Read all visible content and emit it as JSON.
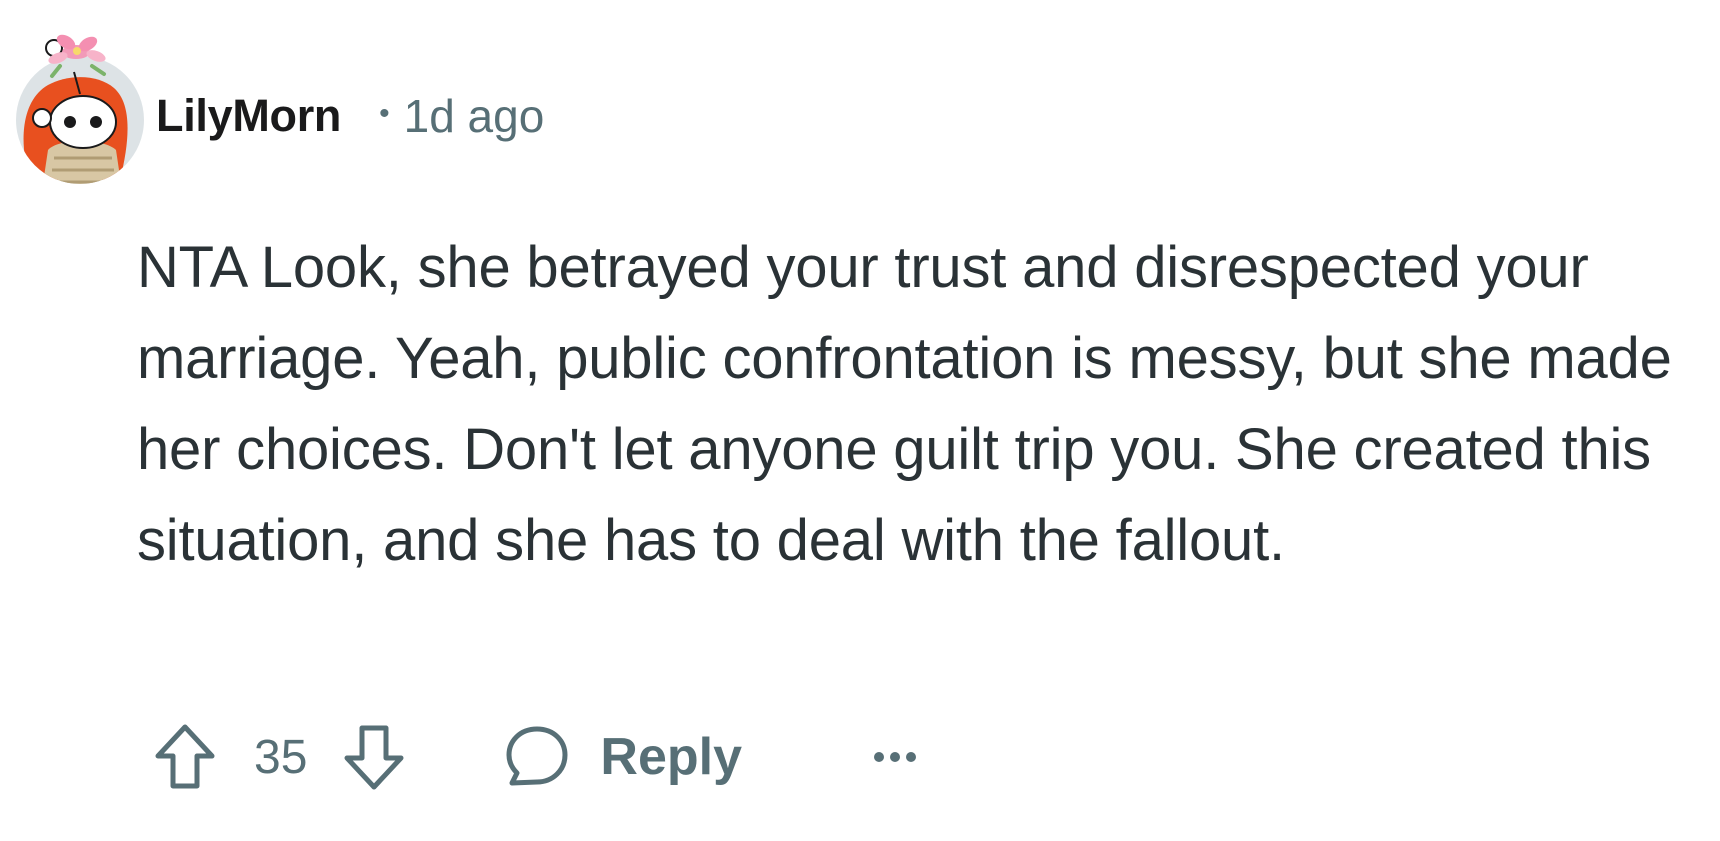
{
  "comment": {
    "author": "LilyMorn",
    "separator": "•",
    "timestamp": "1d ago",
    "body": "NTA Look, she betrayed your trust and disrespected your marriage. Yeah, public confrontation is messy, but she made her choices. Don't let anyone guilt trip you. She created this situation, and she has to deal with the fallout.",
    "score": "35",
    "reply_label": "Reply",
    "more_label": "•••"
  },
  "icons": {
    "avatar": "snoo-avatar-icon",
    "upvote": "arrow-up-icon",
    "downvote": "arrow-down-icon",
    "reply": "speech-bubble-icon",
    "more": "ellipsis-icon"
  },
  "colors": {
    "meta": "#576f76",
    "text": "#2a3236",
    "username": "#1a1a1b"
  }
}
